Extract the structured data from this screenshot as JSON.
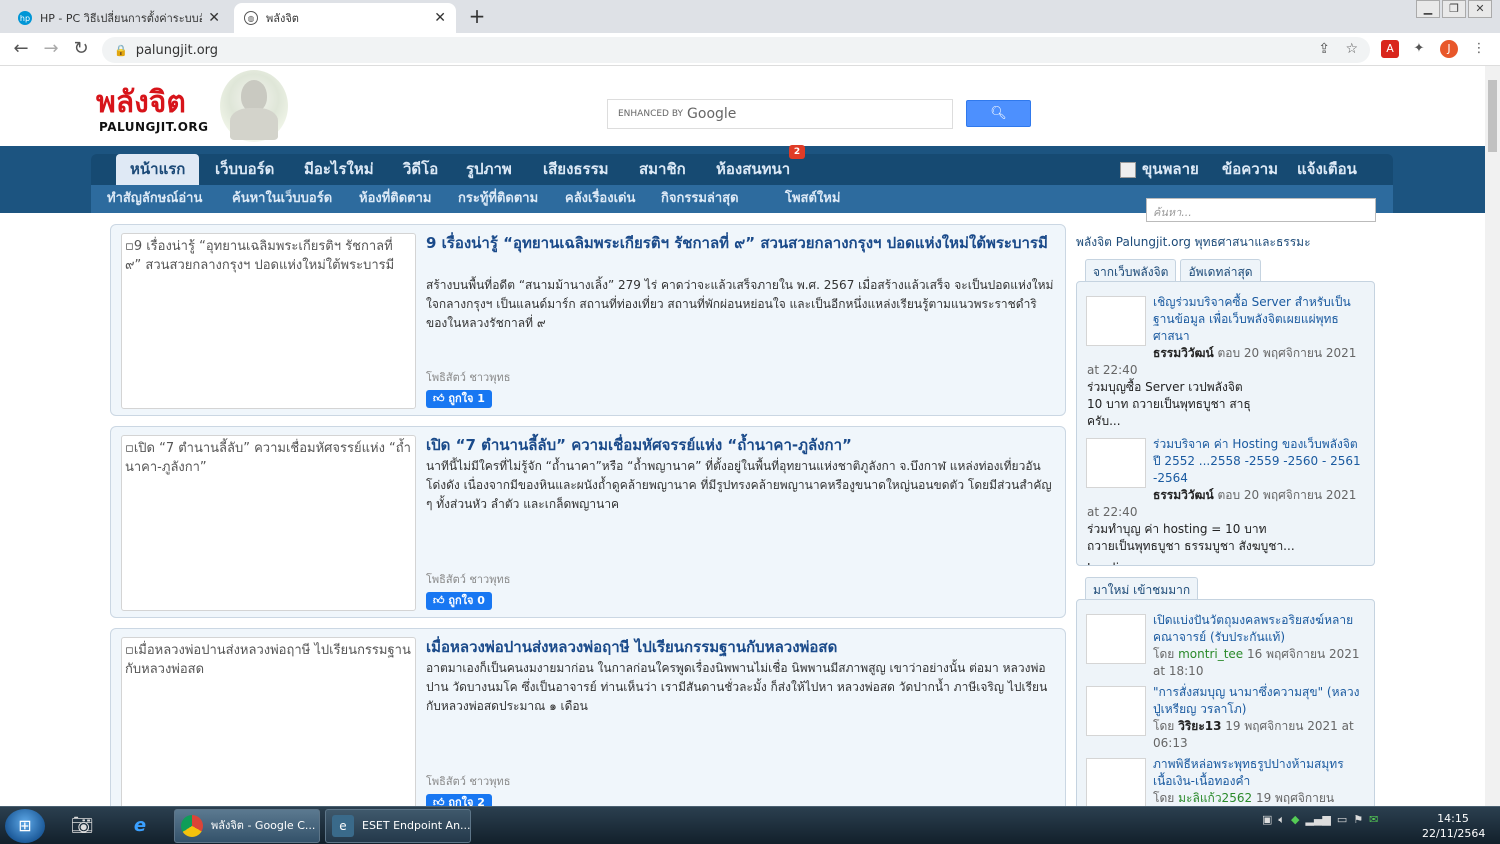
{
  "browser": {
    "tabs": [
      {
        "title": "HP - PC วิธีเปลี่ยนการตั้งค่าระบบอัพเดต",
        "icon": "hp-icon",
        "active": false
      },
      {
        "title": "พลังจิต",
        "icon": "globe-icon",
        "active": true
      }
    ],
    "url": "palungjit.org",
    "profile_initial": "J"
  },
  "site": {
    "logo_th": "พลังจิต",
    "logo_en": "PALUNGJIT.ORG",
    "search": {
      "enhanced_label": "ENHANCED BY",
      "google_label": "Google",
      "value": ""
    },
    "nav": [
      "หน้าแรก",
      "เว็บบอร์ด",
      "มีอะไรใหม่",
      "วิดีโอ",
      "รูปภาพ",
      "เสียงธรรม",
      "สมาชิก",
      "ห้องสนทนา"
    ],
    "nav_badge": "2",
    "nav_right": [
      "ขุนพลาย",
      "ข้อความ",
      "แจ้งเตือน"
    ],
    "subnav": [
      "ทำสัญลักษณ์อ่าน",
      "ค้นหาในเว็บบอร์ด",
      "ห้องที่ติดตาม",
      "กระทู้ที่ติดตาม",
      "คลังเรื่องเด่น",
      "กิจกรรมล่าสุด",
      "โพสต์ใหม่"
    ],
    "quick_search_placeholder": "ค้นหา..."
  },
  "posts": [
    {
      "thumb_alt": "9 เรื่องน่ารู้ “อุทยานเฉลิมพระเกียรติฯ รัชกาลที่ ๙” สวนสวยกลางกรุงฯ ปอดแห่งใหม่ใต้พระบารมี",
      "title": "9 เรื่องน่ารู้ “อุทยานเฉลิมพระเกียรติฯ รัชกาลที่ ๙” สวนสวยกลางกรุงฯ ปอดแห่งใหม่ใต้พระบารมี",
      "excerpt": "สร้างบนพื้นที่อดีต “สนามม้านางเลิ้ง” 279 ไร่ คาดว่าจะแล้วเสร็จภายใน พ.ศ. 2567 เมื่อสร้างแล้วเสร็จ จะเป็นปอดแห่งใหม่ใจกลางกรุงฯ เป็นแลนด์มาร์ก สถานที่ท่องเที่ยว สถานที่พักผ่อนหย่อนใจ และเป็นอีกหนึ่งแหล่งเรียนรู้ตามแนวพระราชดำริของในหลวงรัชกาลที่ ๙",
      "author": "โพธิสัตว์ ชาวพุทธ",
      "likes": "ถูกใจ 1"
    },
    {
      "thumb_alt": "เปิด “7 ตำนานลี้ลับ” ความเชื่อมหัศจรรย์แห่ง “ถ้ำนาคา-ภูลังกา”",
      "title": "เปิด “7 ตำนานลี้ลับ” ความเชื่อมหัศจรรย์แห่ง “ถ้ำนาคา-ภูลังกา”",
      "excerpt": "นาทีนี้ไม่มีใครที่ไม่รู้จัก “ถ้ำนาคา”หรือ “ถ้ำพญานาค” ที่ตั้งอยู่ในพื้นที่อุทยานแห่งชาติภูลังกา จ.บึงกาฬ แหล่งท่องเที่ยวอันโด่งดัง เนื่องจากมีของหินและผนังถ้ำดูคล้ายพญานาค ที่มีรูปทรงคล้ายพญานาคหรืองูขนาดใหญ่นอนขดตัว โดยมีส่วนสำคัญ ๆ ทั้งส่วนหัว ลำตัว และเกล็ดพญานาค",
      "author": "โพธิสัตว์ ชาวพุทธ",
      "likes": "ถูกใจ 0"
    },
    {
      "thumb_alt": "เมื่อหลวงพ่อปานส่งหลวงพ่อฤาษี ไปเรียนกรรมฐานกับหลวงพ่อสด",
      "title": "เมื่อหลวงพ่อปานส่งหลวงพ่อฤาษี ไปเรียนกรรมฐานกับหลวงพ่อสด",
      "excerpt": "อาตมาเองก็เป็นคนงมงายมาก่อน ในกาลก่อนใครพูดเรื่องนิพพานไม่เชื่อ นิพพานมีสภาพสูญ เขาว่าอย่างนั้น ต่อมา หลวงพ่อปาน วัดบางนมโค ซึ่งเป็นอาจารย์ ท่านเห็นว่า เรามีสันดานชั่วละมั้ง ก็ส่งให้ไปหา หลวงพ่อสด วัดปากน้ำ ภาษีเจริญ ไปเรียนกับหลวงพ่อสดประมาณ ๑ เดือน",
      "author": "โพธิสัตว์ ชาวพุทธ",
      "likes": "ถูกใจ 2"
    }
  ],
  "sidebar": {
    "heading": "พลังจิต Palungjit.org พุทธศาสนาและธรรมะ",
    "tabs1": [
      "จากเว็บพลังจิต",
      "อัพเดทล่าสุด"
    ],
    "box1": [
      {
        "title": "เชิญร่วมบริจาคซื้อ Server สำหรับเป็นฐานข้อมูล เพื่อเว็บพลังจิตเผยแผ่พุทธศาสนา",
        "user": "ธรรมวิวัฒน์",
        "meta": "ตอบ 20 พฤศจิกายน 2021",
        "time": "at 22:40",
        "snippet": "ร่วมบุญซื้อ Server เวปพลังจิต 10 บาท ถวายเป็นพุทธบูชา สาธุครับ..."
      },
      {
        "title": "ร่วมบริจาค ค่า Hosting ของเว็บพลังจิต ปี 2552 ...2558 -2559 -2560 - 2561 -2564",
        "user": "ธรรมวิวัฒน์",
        "meta": "ตอบ 20 พฤศจิกายน 2021",
        "time": "at 22:40",
        "snippet": "ร่วมทำบุญ ค่า hosting = 10 บาท ถวายเป็นพุทธบูชา ธรรมบูชา สังฆบูชา..."
      }
    ],
    "loading": "Loading...",
    "tabs2": [
      "มาใหม่ เข้าชมมาก"
    ],
    "box2": [
      {
        "title": "เปิดแบ่งปันวัตถุมงคลพระอริยสงฆ์หลายคณาจารย์ (รับประกันแท้)",
        "by": "โดย",
        "user": "montri_tee",
        "meta": "16 พฤศจิกายน 2021 at 18:10"
      },
      {
        "title": "\"การสั่งสมบุญ นามาซึ่งความสุข\" (หลวงปู่เหรียญ วรลาโภ)",
        "by": "โดย",
        "user": "วิริยะ13",
        "meta": "19 พฤศจิกายน 2021 at 06:13"
      },
      {
        "title": "ภาพพิธีหล่อพระพุทธรูปปางห้ามสมุทร เนื้อเงิน-เนื้อทองคำ",
        "by": "โดย",
        "user": "มะลิแก้ว2562",
        "meta": "19 พฤศจิกายน"
      }
    ]
  },
  "taskbar": {
    "tasks": [
      {
        "label": "พลังจิต - Google C...",
        "icon": "chrome-icon"
      },
      {
        "label": "ESET Endpoint An...",
        "icon": "eset-icon"
      }
    ],
    "time": "14:15",
    "date": "22/11/2564"
  },
  "colors": {
    "nav_bg": "#164a72",
    "band_bg": "#1c5480",
    "logo_red": "#d7141a",
    "link_blue": "#1a4a8a",
    "like_blue": "#1877f2"
  }
}
